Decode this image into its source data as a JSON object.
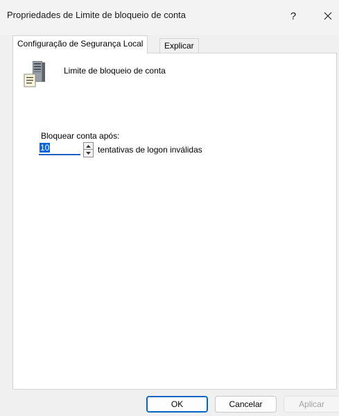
{
  "window": {
    "title": "Propriedades de Limite de bloqueio de conta",
    "help_label": "?",
    "close_label": "close"
  },
  "tabs": [
    {
      "label": "Configuração de Segurança Local",
      "active": true
    },
    {
      "label": "Explicar",
      "active": false
    }
  ],
  "policy": {
    "icon": "server-policy-icon",
    "name": "Limite de bloqueio de conta"
  },
  "lockout": {
    "label": "Bloquear conta após:",
    "value": "10",
    "unit_label": "tentativas de logon inválidas"
  },
  "buttons": {
    "ok": "OK",
    "cancel": "Cancelar",
    "apply": "Aplicar"
  },
  "colors": {
    "accent": "#0067c0",
    "selection": "#0a64d6",
    "disabled_text": "#a0a0a0"
  }
}
